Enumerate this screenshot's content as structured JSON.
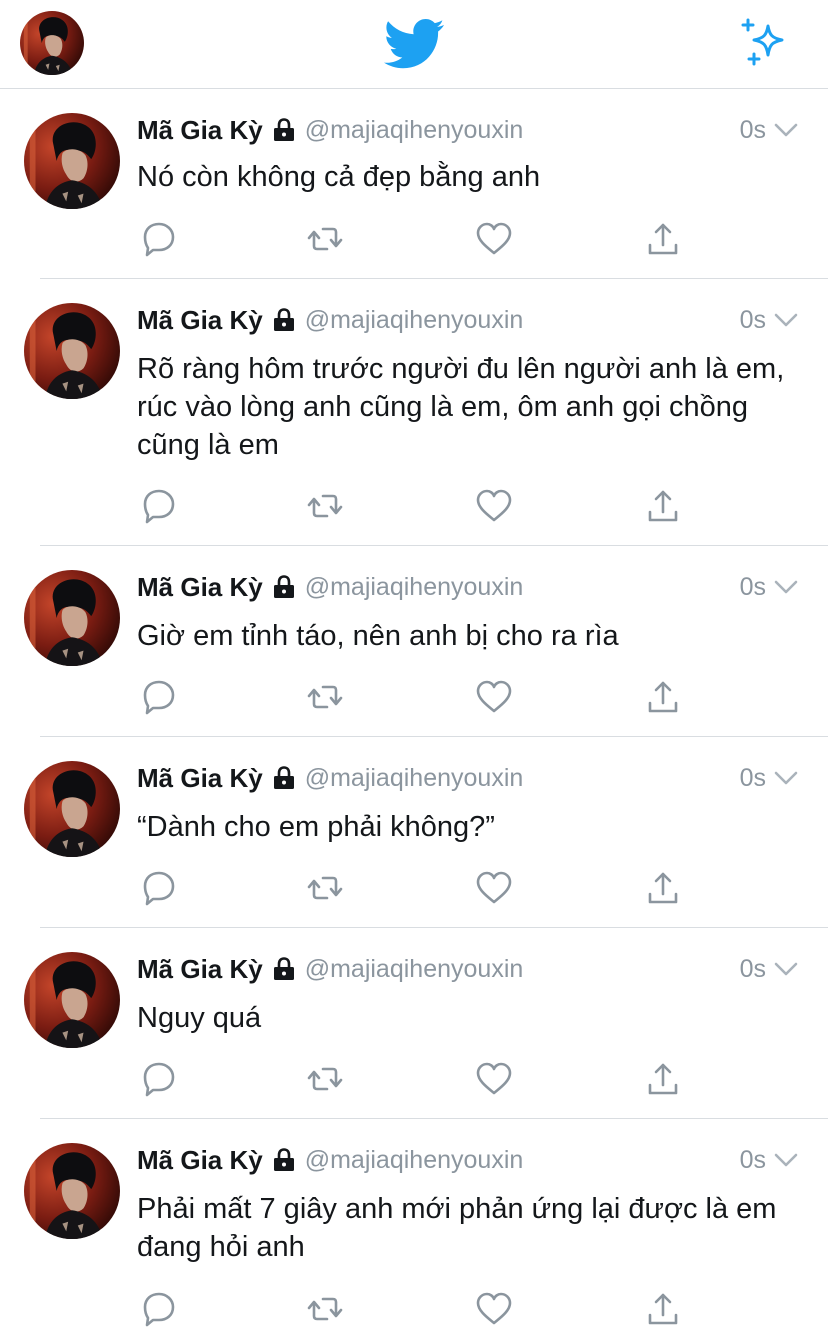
{
  "header": {
    "logo_icon": "twitter-bird-icon",
    "compose_icon": "sparkle-icon",
    "brand_color": "#1da1f2"
  },
  "tweets": [
    {
      "name": "Mã Gia Kỳ",
      "handle": "@majiaqihenyouxin",
      "time": "0s",
      "text": "Nó còn không cả đẹp bằng anh"
    },
    {
      "name": "Mã Gia Kỳ",
      "handle": "@majiaqihenyouxin",
      "time": "0s",
      "text": "Rõ ràng hôm trước người đu lên người anh là em, rúc vào lòng anh cũng là em, ôm anh gọi chồng cũng là em"
    },
    {
      "name": "Mã Gia Kỳ",
      "handle": "@majiaqihenyouxin",
      "time": "0s",
      "text": "Giờ em tỉnh táo, nên anh bị cho ra rìa"
    },
    {
      "name": "Mã Gia Kỳ",
      "handle": "@majiaqihenyouxin",
      "time": "0s",
      "text": "“Dành cho em phải không?”"
    },
    {
      "name": "Mã Gia Kỳ",
      "handle": "@majiaqihenyouxin",
      "time": "0s",
      "text": "Nguy quá"
    },
    {
      "name": "Mã Gia Kỳ",
      "handle": "@majiaqihenyouxin",
      "time": "0s",
      "text": "Phải mất 7 giây anh mới phản ứng lại được là em đang hỏi anh"
    }
  ]
}
